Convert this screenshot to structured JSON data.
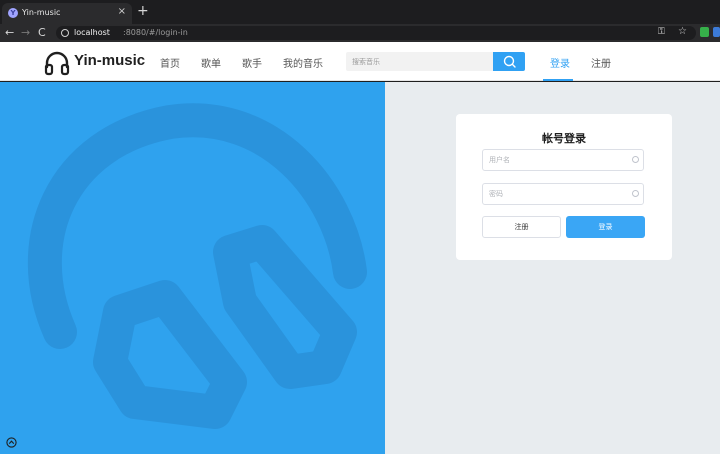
{
  "browser": {
    "tab_title": "Yin-music",
    "tab_close": "×",
    "new_tab": "+",
    "url_host": "localhost",
    "url_path": ":8080/#/login-in",
    "back": "←",
    "forward": "→",
    "reload": "C"
  },
  "header": {
    "logo_text": "Yin-music",
    "nav": [
      "首页",
      "歌单",
      "歌手",
      "我的音乐"
    ],
    "search_placeholder": "搜索音乐",
    "login": "登录",
    "register": "注册"
  },
  "login_card": {
    "title": "帐号登录",
    "username_placeholder": "用户名",
    "password_placeholder": "密码",
    "register_button": "注册",
    "login_button": "登录"
  },
  "colors": {
    "accent": "#30a1f3",
    "left_panel": "#2fa2ee",
    "right_panel": "#e8ecef"
  }
}
